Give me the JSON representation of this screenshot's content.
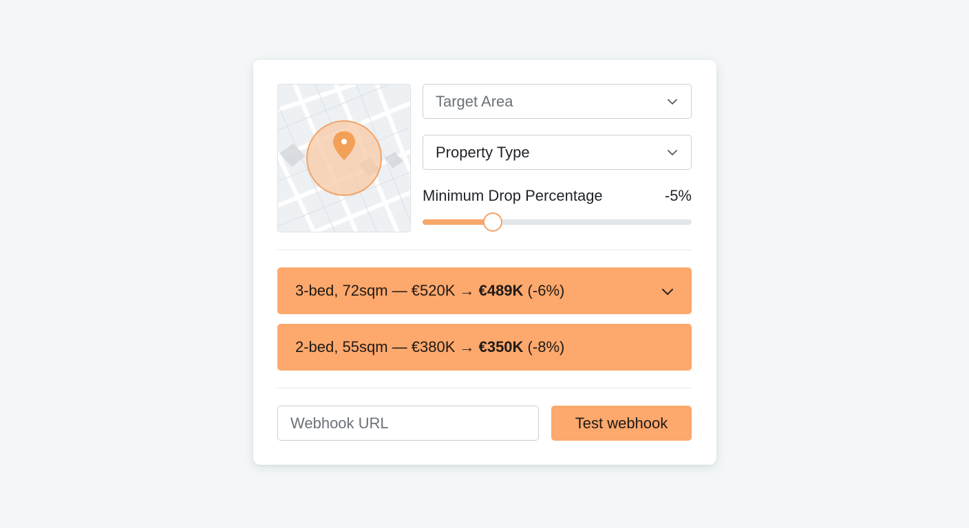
{
  "filters": {
    "target_area": {
      "placeholder": "Target Area"
    },
    "property_type": {
      "value": "Property Type"
    },
    "min_drop": {
      "label": "Minimum Drop Percentage",
      "value_text": "-5%",
      "fill_fraction": 0.26
    }
  },
  "results": [
    {
      "prefix": "3-bed, 72sqm — €520K → ",
      "new_price": "€489K",
      "suffix": " (-6%)",
      "expanded_chevron": "chevron-down-icon"
    },
    {
      "prefix": "2-bed, 55sqm — €380K → ",
      "new_price": "€350K",
      "suffix": " (-8%)"
    }
  ],
  "webhook": {
    "placeholder": "Webhook URL",
    "button_label": "Test webhook"
  },
  "colors": {
    "accent": "#fda86c",
    "map_marker": "#f2a057",
    "background": "#f3f7f8"
  }
}
